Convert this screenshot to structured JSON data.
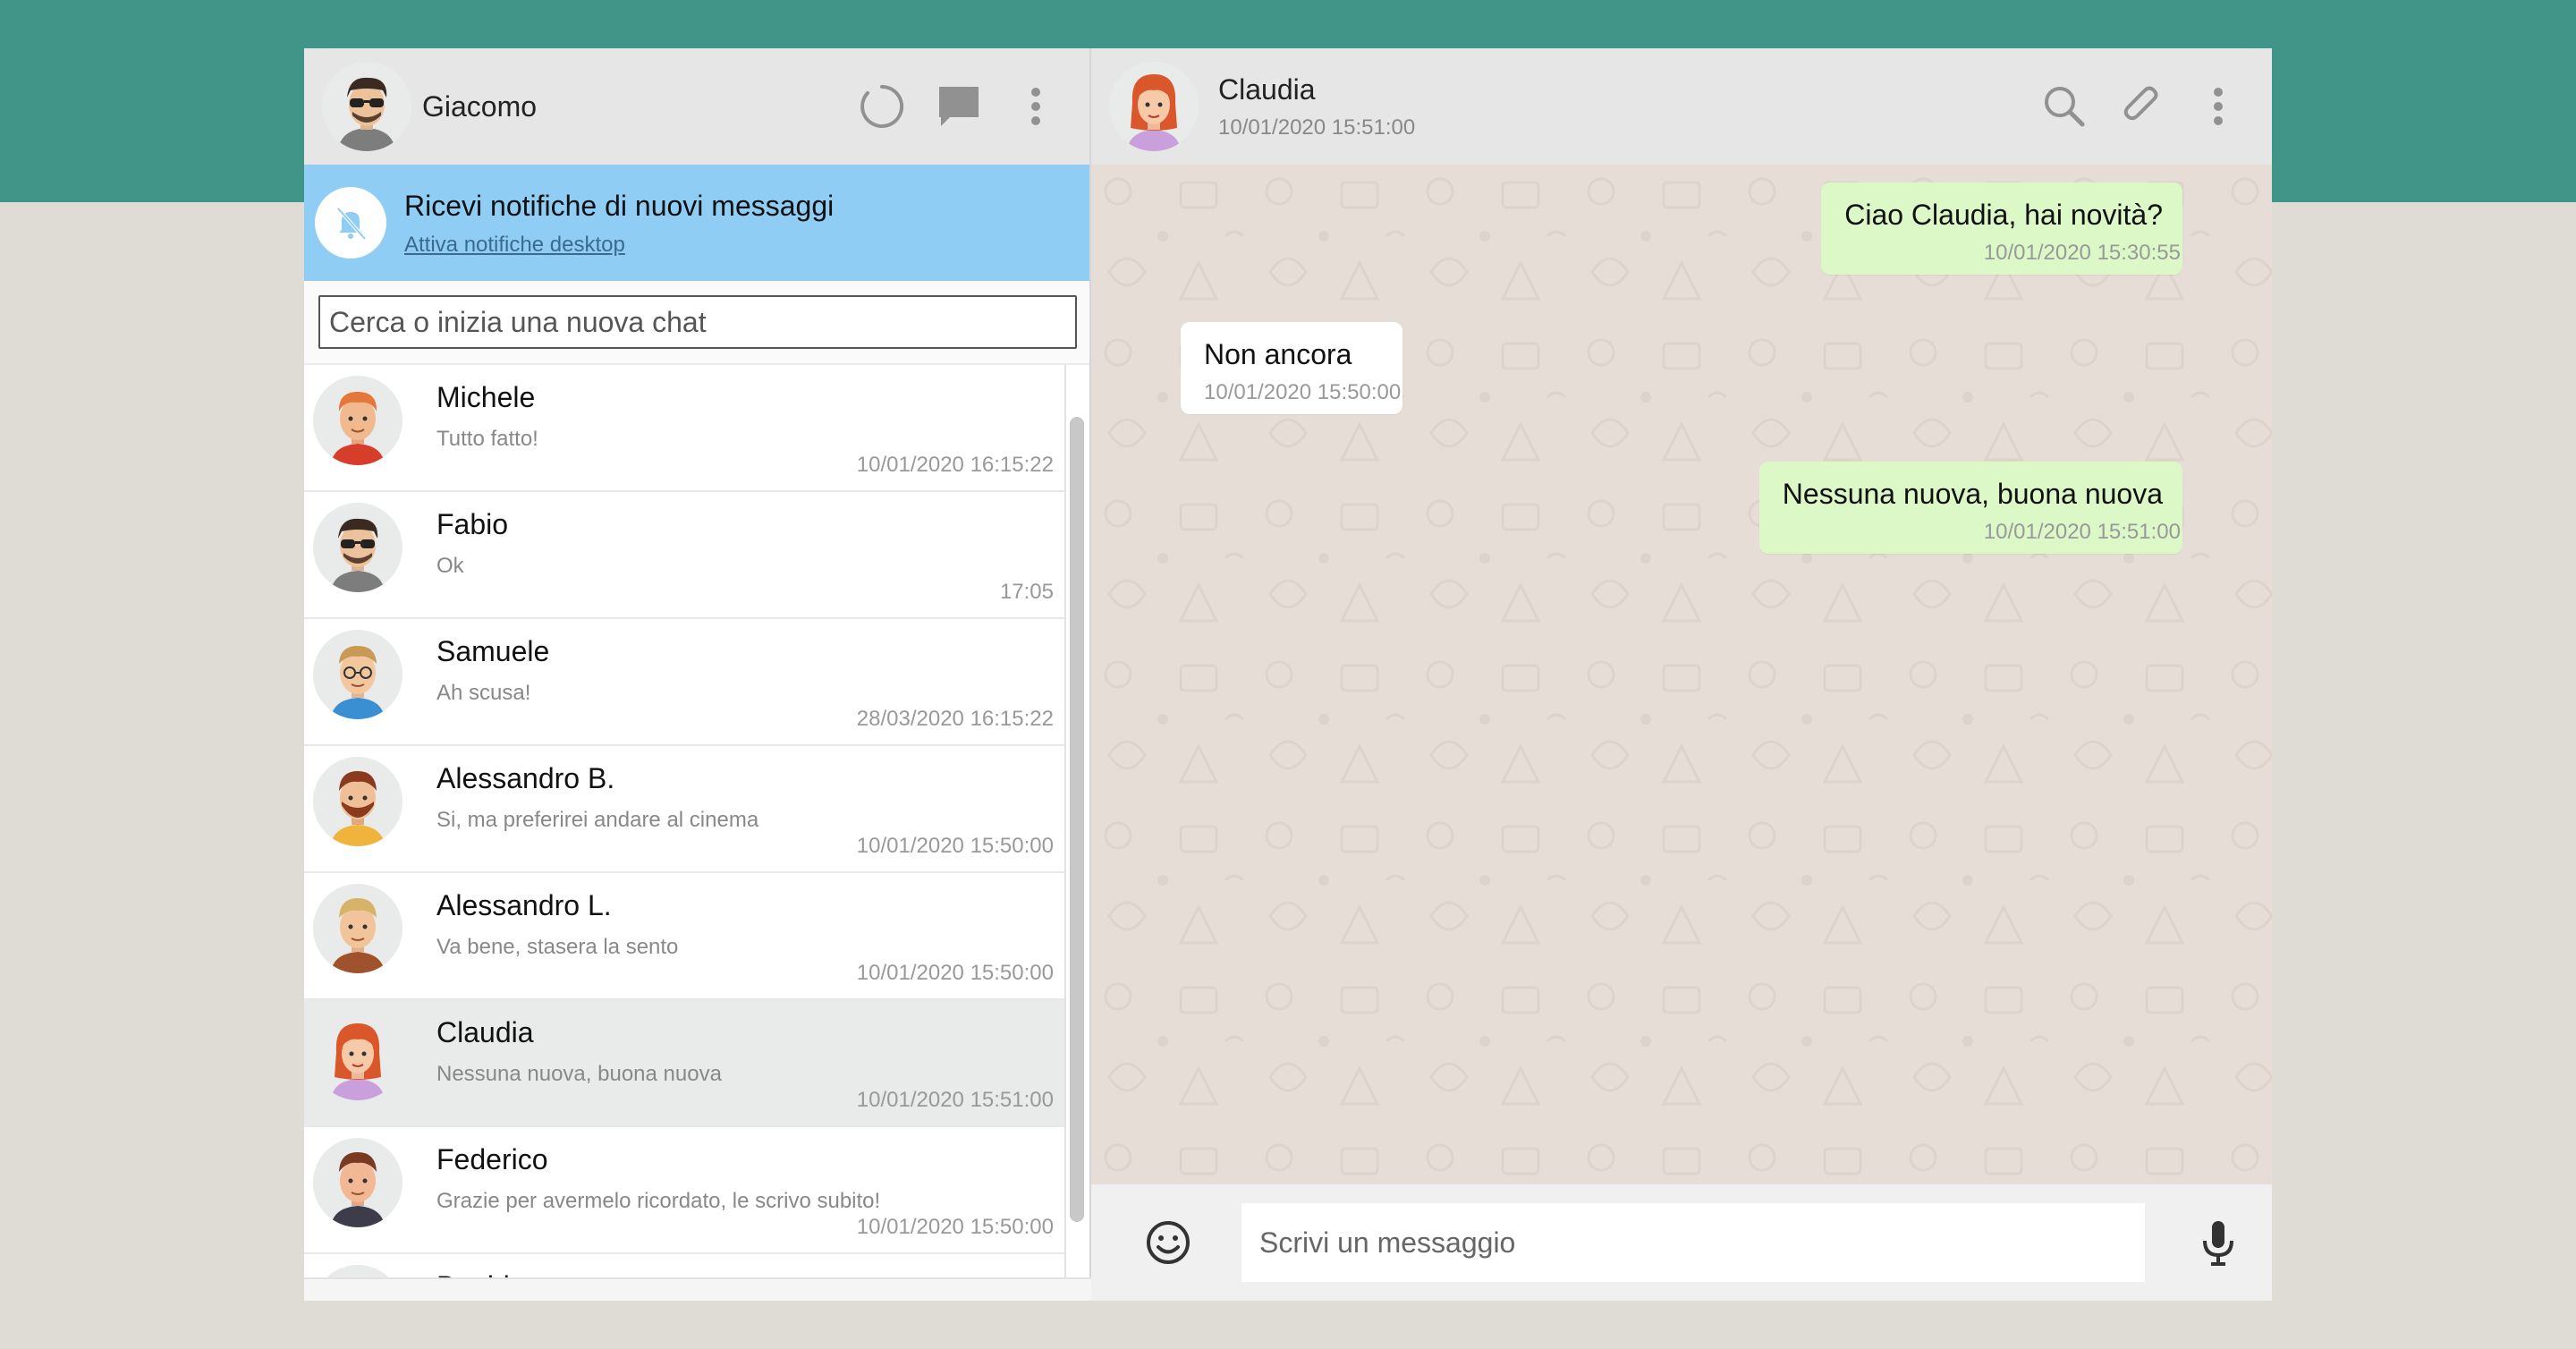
{
  "colors": {
    "band": "#419588",
    "background": "#dedcd5",
    "header": "#e6e6e6",
    "notification": "#8fcdf4",
    "outgoing": "#dcf8c6",
    "incoming": "#ffffff",
    "selected": "#e9eaea"
  },
  "user": {
    "name": "Giacomo"
  },
  "header_icons": [
    "status-icon",
    "new-chat-icon",
    "menu-dots-icon"
  ],
  "notification": {
    "title": "Ricevi notifiche di nuovi messaggi",
    "link": "Attiva notifiche desktop",
    "icon": "bell-off-icon"
  },
  "search": {
    "placeholder": "Cerca o inizia una nuova chat"
  },
  "chats": [
    {
      "name": "Michele",
      "last": "Tutto fatto!",
      "time": "10/01/2020 16:15:22"
    },
    {
      "name": "Fabio",
      "last": "Ok",
      "time": "17:05"
    },
    {
      "name": "Samuele",
      "last": "Ah scusa!",
      "time": "28/03/2020 16:15:22"
    },
    {
      "name": "Alessandro B.",
      "last": "Si, ma preferirei andare al cinema",
      "time": "10/01/2020 15:50:00"
    },
    {
      "name": "Alessandro L.",
      "last": "Va bene, stasera la sento",
      "time": "10/01/2020 15:50:00"
    },
    {
      "name": "Claudia",
      "last": "Nessuna nuova, buona nuova",
      "time": "10/01/2020 15:51:00"
    },
    {
      "name": "Federico",
      "last": "Grazie per avermelo ricordato, le scrivo subito!",
      "time": "10/01/2020 15:50:00"
    },
    {
      "name": "Davide",
      "last": "",
      "time": ""
    }
  ],
  "active_chat": {
    "name": "Claudia",
    "last_seen": "10/01/2020 15:51:00",
    "icons": [
      "search-icon",
      "attach-icon",
      "menu-dots-icon"
    ],
    "messages": [
      {
        "text": "Ciao Claudia, hai novità?",
        "time": "10/01/2020 15:30:55",
        "direction": "sent"
      },
      {
        "text": "Non ancora",
        "time": "10/01/2020 15:50:00",
        "direction": "received"
      },
      {
        "text": "Nessuna nuova, buona nuova",
        "time": "10/01/2020 15:51:00",
        "direction": "sent"
      }
    ]
  },
  "composer": {
    "placeholder": "Scrivi un messaggio",
    "emoji_icon": "emoji-icon",
    "mic_icon": "microphone-icon"
  }
}
